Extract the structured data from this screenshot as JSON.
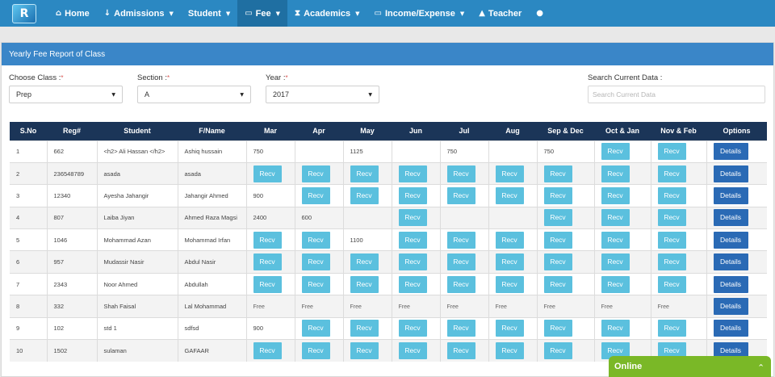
{
  "nav": {
    "logo": "R",
    "items": [
      {
        "label": "Home",
        "icon": "⌂",
        "icon_name": "home-icon",
        "dropdown": false
      },
      {
        "label": "Admissions",
        "icon": "↓",
        "icon_name": "download-arrow-icon",
        "dropdown": true
      },
      {
        "label": "Student",
        "icon": "",
        "icon_name": "",
        "dropdown": true
      },
      {
        "label": "Fee",
        "icon": "▭",
        "icon_name": "money-icon",
        "dropdown": true
      },
      {
        "label": "Academics",
        "icon": "⧗",
        "icon_name": "hourglass-icon",
        "dropdown": true
      },
      {
        "label": "Income/Expense",
        "icon": "▭",
        "icon_name": "money-icon",
        "dropdown": true
      },
      {
        "label": "Teacher",
        "icon": "▲",
        "icon_name": "graduation-cap-icon",
        "dropdown": false
      },
      {
        "label": "",
        "icon": "●",
        "icon_name": "user-icon",
        "dropdown": false
      }
    ]
  },
  "panel": {
    "title": "Yearly Fee Report of Class"
  },
  "filters": {
    "class": {
      "label": "Choose Class :",
      "value": "Prep"
    },
    "section": {
      "label": "Section :",
      "value": "A"
    },
    "year": {
      "label": "Year :",
      "value": "2017"
    },
    "search": {
      "label": "Search Current Data :",
      "placeholder": "Search Current Data",
      "value": ""
    }
  },
  "table": {
    "recv_label": "Recv",
    "details_label": "Details",
    "columns": [
      "S.No",
      "Reg#",
      "Student",
      "F/Name",
      "Mar",
      "Apr",
      "May",
      "Jun",
      "Jul",
      "Aug",
      "Sep & Dec",
      "Oct & Jan",
      "Nov & Feb",
      "Options"
    ],
    "rows": [
      {
        "sno": "1",
        "reg": "662",
        "student": "<h2> Ali Hassan </h2>",
        "fname": "Ashiq hussain",
        "months": [
          "750",
          "",
          "1125",
          "",
          "750",
          "",
          "750",
          "recv",
          "recv"
        ]
      },
      {
        "sno": "2",
        "reg": "236548789",
        "student": "asada",
        "fname": "asada",
        "months": [
          "recv",
          "recv",
          "recv",
          "recv",
          "recv",
          "recv",
          "recv",
          "recv",
          "recv"
        ]
      },
      {
        "sno": "3",
        "reg": "12340",
        "student": "Ayesha Jahangir",
        "fname": "Jahangir Ahmed",
        "months": [
          "900",
          "recv",
          "recv",
          "recv",
          "recv",
          "recv",
          "recv",
          "recv",
          "recv"
        ]
      },
      {
        "sno": "4",
        "reg": "807",
        "student": "Laiba Jiyan",
        "fname": "Ahmed Raza Magsi",
        "months": [
          "2400",
          "600",
          "",
          "recv",
          "",
          "",
          "recv",
          "recv",
          "recv"
        ]
      },
      {
        "sno": "5",
        "reg": "1046",
        "student": "Mohammad Azan",
        "fname": "Mohammad Irfan",
        "months": [
          "recv",
          "recv",
          "1100",
          "recv",
          "recv",
          "recv",
          "recv",
          "recv",
          "recv"
        ]
      },
      {
        "sno": "6",
        "reg": "957",
        "student": "Mudassir Nasir",
        "fname": "Abdul Nasir",
        "months": [
          "recv",
          "recv",
          "recv",
          "recv",
          "recv",
          "recv",
          "recv",
          "recv",
          "recv"
        ]
      },
      {
        "sno": "7",
        "reg": "2343",
        "student": "Noor Ahmed",
        "fname": "Abdullah",
        "months": [
          "recv",
          "recv",
          "recv",
          "recv",
          "recv",
          "recv",
          "recv",
          "recv",
          "recv"
        ]
      },
      {
        "sno": "8",
        "reg": "332",
        "student": "Shah Faisal",
        "fname": "Lal Mohammad",
        "months": [
          "Free",
          "Free",
          "Free",
          "Free",
          "Free",
          "Free",
          "Free",
          "Free",
          "Free"
        ]
      },
      {
        "sno": "9",
        "reg": "102",
        "student": "std 1",
        "fname": "sdfsd",
        "months": [
          "900",
          "recv",
          "recv",
          "recv",
          "recv",
          "recv",
          "recv",
          "recv",
          "recv"
        ]
      },
      {
        "sno": "10",
        "reg": "1502",
        "student": "sulaman",
        "fname": "GAFAAR",
        "months": [
          "recv",
          "recv",
          "recv",
          "recv",
          "recv",
          "recv",
          "recv",
          "recv",
          "recv"
        ]
      }
    ]
  },
  "chat": {
    "label": "Online",
    "icon_name": "chevron-up-icon"
  },
  "colors": {
    "navbar": "#2b88c2",
    "panel_heading": "#3a86c8",
    "table_header": "#1b3558",
    "recv": "#5bc0de",
    "details": "#2a6ab5",
    "online": "#7ab827"
  }
}
